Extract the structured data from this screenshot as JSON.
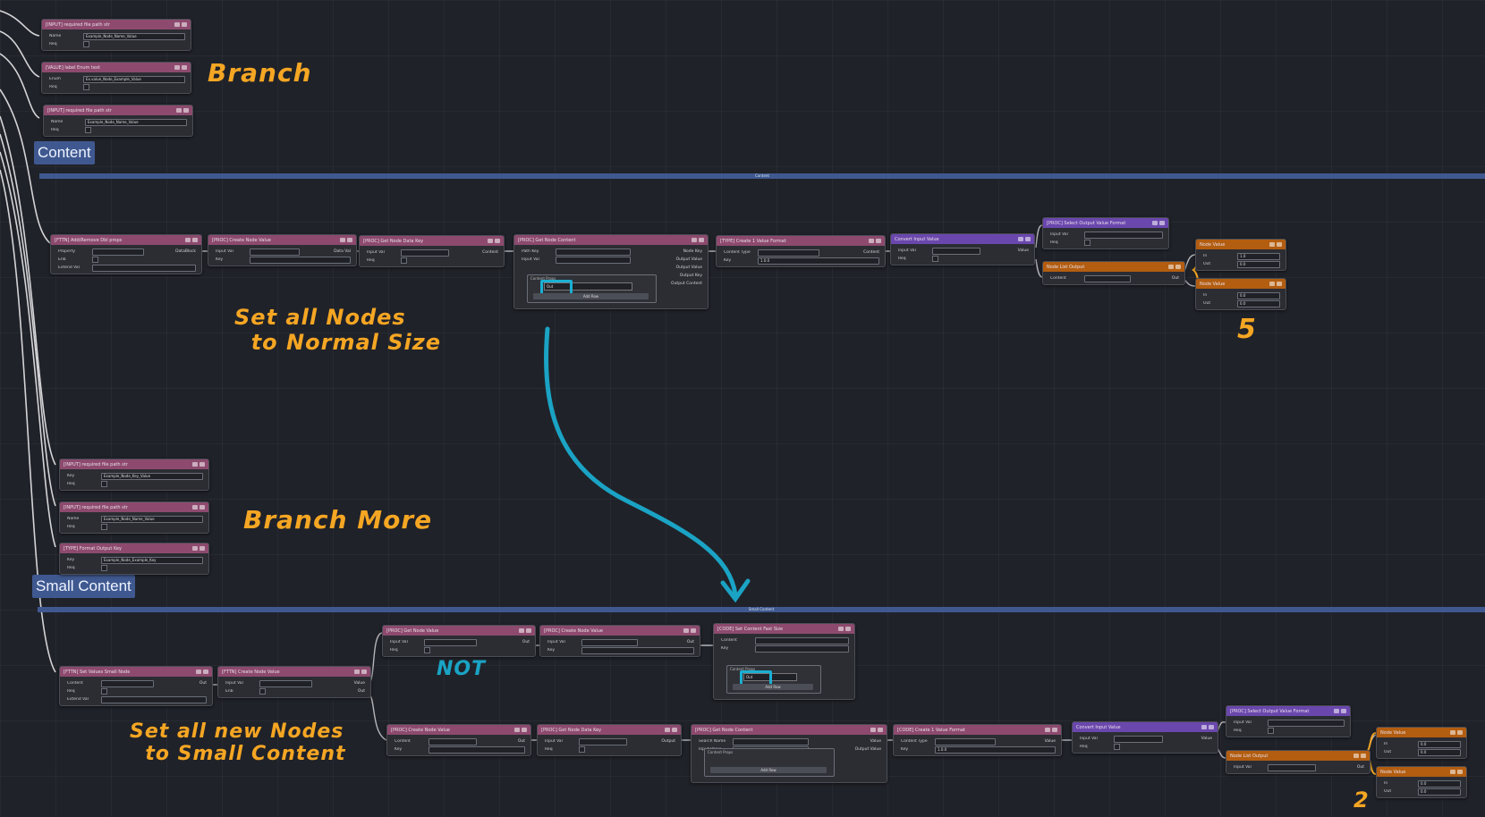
{
  "colors": {
    "background": "#202229",
    "node_pink": "#8d4a6e",
    "node_purple": "#6a47ad",
    "node_orange": "#b35d10",
    "group_blue": "#3f5990",
    "annotation_orange": "#f5a623",
    "annotation_teal": "#1aa3c4"
  },
  "groups": {
    "content": {
      "bar_title": "Content",
      "label": "Content"
    },
    "small_content": {
      "bar_title": "Small Content",
      "label": "Small Content"
    }
  },
  "annotations": {
    "branch": "Branch",
    "set_normal": "Set all Nodes\n  to Normal Size",
    "five": "5",
    "branch_more": "Branch More",
    "not": "NOT",
    "set_small": "Set all new Nodes\n  to Small Content",
    "two": "2"
  },
  "nodes": {
    "n1": {
      "title": "[INPUT] required file path str",
      "rows": [
        {
          "label": "Name",
          "value": "Example_Node_Name_Value"
        },
        {
          "label": "Req",
          "value": ""
        }
      ]
    },
    "n2": {
      "title": "[VALUE] label Enum text",
      "rows": [
        {
          "label": "Enum",
          "value": "Ex.value_Node_Example_Value"
        },
        {
          "label": "Req",
          "value": ""
        }
      ]
    },
    "n3": {
      "title": "[INPUT] required file path str",
      "rows": [
        {
          "label": "Name",
          "value": "Example_Node_Name_Value"
        },
        {
          "label": "Req",
          "value": ""
        }
      ]
    },
    "c1": {
      "title": "[FTTN] Add/Remove Dbl props",
      "rows": [
        {
          "label": "Property",
          "value": "",
          "out": "DataBlock"
        },
        {
          "label": "Enb",
          "value": ""
        },
        {
          "label": "Extend Val",
          "value": ""
        }
      ]
    },
    "c2": {
      "title": "[PROC] Create Node Value",
      "rows": [
        {
          "label": "Input Val",
          "value": "",
          "out": "Data Val"
        },
        {
          "label": "Key",
          "value": ""
        }
      ]
    },
    "c3": {
      "title": "[PROC] Get Node Data Key",
      "rows": [
        {
          "label": "Input Val",
          "value": "",
          "out": "Content"
        },
        {
          "label": "Req",
          "value": ""
        }
      ]
    },
    "c4": {
      "title": "[PROC] Get Node Content",
      "rows": [
        {
          "label": "Path Key",
          "value": "",
          "out": "Node Key"
        },
        {
          "label": "Input Val",
          "value": "",
          "out": "Output Value"
        },
        {
          "label": "",
          "value": "",
          "out": "Output Value"
        },
        {
          "label": "",
          "value": "",
          "out": "Output Key"
        },
        {
          "label": "",
          "value": "",
          "out": "Output Content"
        }
      ],
      "subgroup": "Content Props",
      "sel": "Out",
      "button": "Add Row"
    },
    "c5": {
      "title": "[TYPE] Create 1 Value Format",
      "rows": [
        {
          "label": "Content Type",
          "value": "",
          "out": "Content"
        },
        {
          "label": "Key",
          "value": "1.0.0"
        }
      ]
    },
    "c6": {
      "title": "Convert Input Value",
      "rows": [
        {
          "label": "Input Val",
          "value": "",
          "out": "Value"
        },
        {
          "label": "Req",
          "value": ""
        }
      ]
    },
    "c7": {
      "title": "[PROC] Select Output Value Format",
      "rows": [
        {
          "label": "Input Val",
          "value": ""
        },
        {
          "label": "Req",
          "value": ""
        }
      ]
    },
    "c8": {
      "title": "Node List Output",
      "rows": [
        {
          "label": "Content",
          "value": "",
          "out": "Out"
        }
      ]
    },
    "c9": {
      "title": "Node Value",
      "rows": [
        {
          "label": "In",
          "value": "1.0"
        },
        {
          "label": "Out",
          "value": "0.0"
        }
      ]
    },
    "c10": {
      "title": "Node Value",
      "rows": [
        {
          "label": "In",
          "value": "0.0"
        },
        {
          "label": "Out",
          "value": "0.0"
        }
      ]
    },
    "m1": {
      "title": "[INPUT] required file path str",
      "rows": [
        {
          "label": "Key",
          "value": "Example_Node_Key_Value"
        },
        {
          "label": "Req",
          "value": ""
        }
      ]
    },
    "m2": {
      "title": "[INPUT] required file path str",
      "rows": [
        {
          "label": "Name",
          "value": "Example_Node_Name_Value"
        },
        {
          "label": "Req",
          "value": ""
        }
      ]
    },
    "m3": {
      "title": "[TYPE] Format Output Key",
      "rows": [
        {
          "label": "Key",
          "value": "Example_Node_Example_Key"
        },
        {
          "label": "Req",
          "value": ""
        }
      ]
    },
    "s1": {
      "title": "[FTTN] Set Values Small Node",
      "rows": [
        {
          "label": "Content",
          "value": "",
          "out": "Out"
        },
        {
          "label": "Req",
          "value": ""
        },
        {
          "label": "Extend Val",
          "value": ""
        }
      ]
    },
    "s2": {
      "title": "[FTTN] Create Node Value",
      "rows": [
        {
          "label": "Input Val",
          "value": "",
          "out": "Value"
        },
        {
          "label": "Enb",
          "value": "",
          "out": "Out"
        }
      ]
    },
    "s3": {
      "title": "[PROC] Get Node Value",
      "rows": [
        {
          "label": "Input Val",
          "value": "",
          "out": "Out"
        },
        {
          "label": "Req",
          "value": ""
        }
      ]
    },
    "s4": {
      "title": "[PROC] Create Node Value",
      "rows": [
        {
          "label": "Input Val",
          "value": "",
          "out": "Out"
        },
        {
          "label": "Key",
          "value": ""
        }
      ]
    },
    "s5": {
      "title": "[CODE] Set Content Fast Size",
      "rows": [
        {
          "label": "Content",
          "value": ""
        },
        {
          "label": "Key",
          "value": ""
        }
      ],
      "subgroup": "Content Props",
      "sel": "Out",
      "button": "Add Row"
    },
    "s6": {
      "title": "[PROC] Create Node Value",
      "rows": [
        {
          "label": "Content",
          "value": "",
          "out": "Out"
        },
        {
          "label": "Key",
          "value": ""
        }
      ]
    },
    "s7": {
      "title": "[PROC] Get Node Data Key",
      "rows": [
        {
          "label": "Input Val",
          "value": "",
          "out": "Output"
        },
        {
          "label": "Req",
          "value": ""
        }
      ]
    },
    "s8": {
      "title": "[PROC] Get Node Content",
      "rows": [
        {
          "label": "Search Name",
          "value": "",
          "out": "Value"
        },
        {
          "label": "Input Value",
          "value": "",
          "out": "Output Value"
        }
      ],
      "subgroup": "Content Props",
      "button": "Add Row"
    },
    "s9": {
      "title": "[CODE] Create 1 Value Format",
      "rows": [
        {
          "label": "Content Type",
          "value": "",
          "out": "Value"
        },
        {
          "label": "Key",
          "value": "1.0.0"
        }
      ]
    },
    "s10": {
      "title": "Convert Input Value",
      "rows": [
        {
          "label": "Input Val",
          "value": "",
          "out": "Value"
        },
        {
          "label": "Req",
          "value": ""
        }
      ]
    },
    "s11": {
      "title": "[PROC] Select Output Value Format",
      "rows": [
        {
          "label": "Input Val",
          "value": ""
        },
        {
          "label": "Req",
          "value": ""
        }
      ]
    },
    "s12": {
      "title": "Node List Output",
      "rows": [
        {
          "label": "Input Val",
          "value": "",
          "out": "Out"
        }
      ]
    },
    "s13": {
      "title": "Node Value",
      "rows": [
        {
          "label": "In",
          "value": "0.0"
        },
        {
          "label": "Out",
          "value": "0.0"
        }
      ]
    },
    "s14": {
      "title": "Node Value",
      "rows": [
        {
          "label": "In",
          "value": "0.0"
        },
        {
          "label": "Out",
          "value": "0.0"
        }
      ]
    }
  }
}
